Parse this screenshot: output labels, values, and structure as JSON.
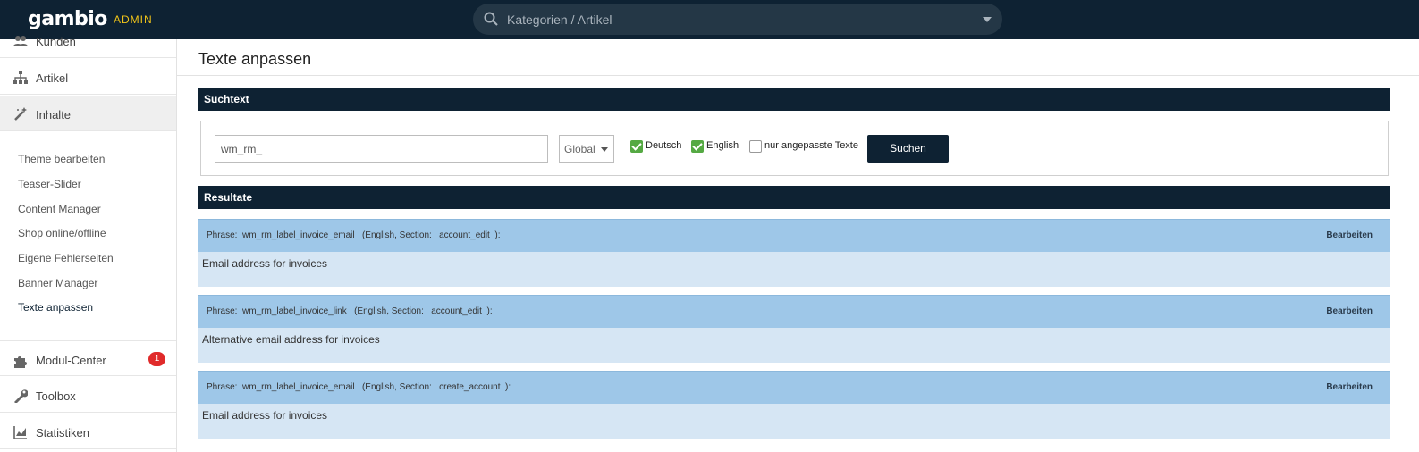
{
  "header": {
    "logo": "gambio",
    "admin_label": "ADMIN",
    "search_placeholder": "Kategorien / Artikel"
  },
  "sidebar": {
    "items": [
      {
        "label": "Kunden",
        "icon": "users-icon"
      },
      {
        "label": "Artikel",
        "icon": "sitemap-icon"
      },
      {
        "label": "Inhalte",
        "icon": "magic-wand-icon"
      }
    ],
    "subitems": [
      "Theme bearbeiten",
      "Teaser-Slider",
      "Content Manager",
      "Shop online/offline",
      "Eigene Fehlerseiten",
      "Banner Manager",
      "Texte anpassen"
    ],
    "bottom_items": [
      {
        "label": "Modul-Center",
        "icon": "puzzle-icon",
        "badge": "1"
      },
      {
        "label": "Toolbox",
        "icon": "wrench-icon"
      },
      {
        "label": "Statistiken",
        "icon": "chart-icon"
      }
    ]
  },
  "main": {
    "title": "Texte anpassen",
    "search_section": "Suchtext",
    "search_value": "wm_rm_",
    "scope_select": "Global",
    "checkbox_de": "Deutsch",
    "checkbox_en": "English",
    "checkbox_custom": "nur angepasste Texte",
    "search_button": "Suchen",
    "results_section": "Resultate",
    "results": [
      {
        "meta": "Phrase:  wm_rm_label_invoice_email   (English, Section:   account_edit  ):",
        "edit": "Bearbeiten",
        "text": "Email address for invoices"
      },
      {
        "meta": "Phrase:  wm_rm_label_invoice_link   (English, Section:   account_edit  ):",
        "edit": "Bearbeiten",
        "text": "Alternative email address for invoices"
      },
      {
        "meta": "Phrase:  wm_rm_label_invoice_email   (English, Section:   create_account  ):",
        "edit": "Bearbeiten",
        "text": "Email address for invoices"
      }
    ]
  }
}
